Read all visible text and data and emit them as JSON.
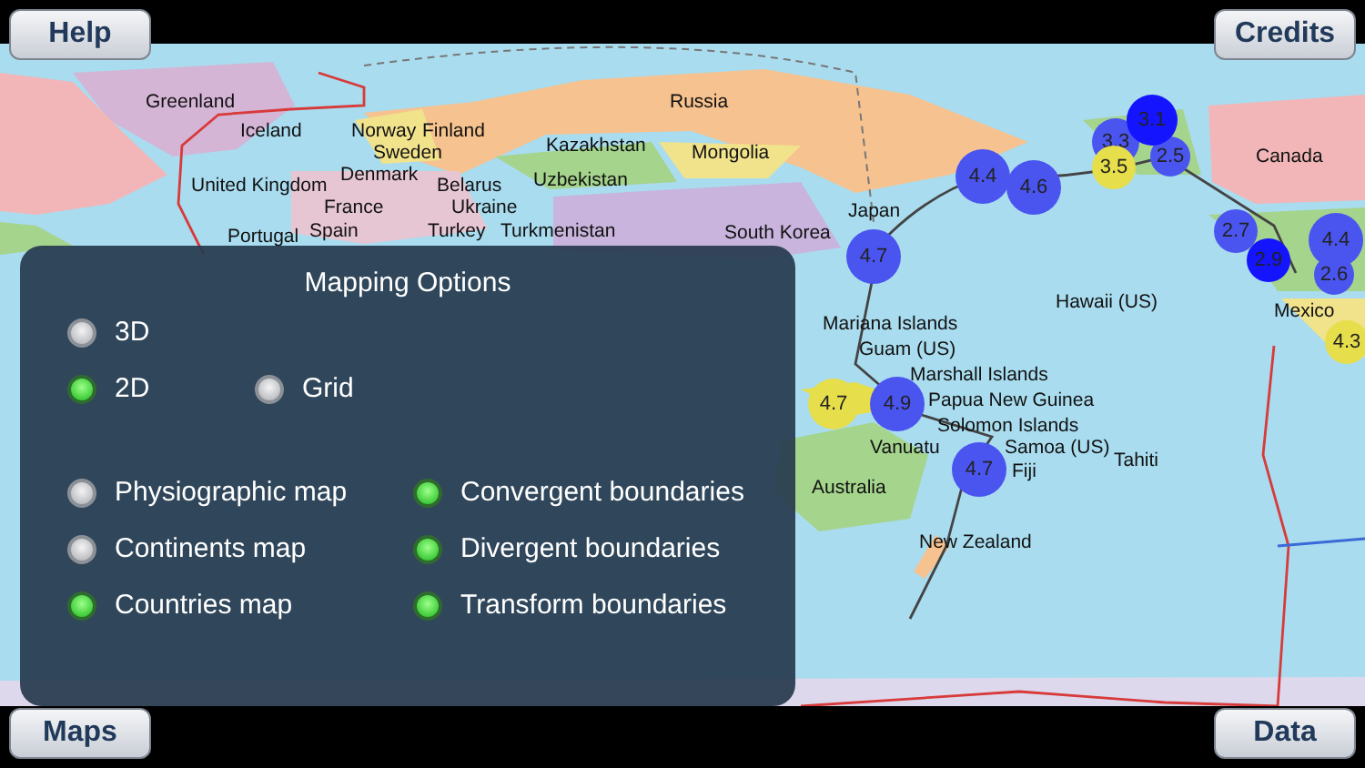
{
  "top_buttons": [
    {
      "label": "Help"
    },
    {
      "label": "Credits"
    }
  ],
  "bottom_buttons": [
    {
      "label": "Maps"
    },
    {
      "label": "Data"
    }
  ],
  "map_labels": [
    "Greenland",
    "Iceland",
    "Norway",
    "Finland",
    "Sweden",
    "Denmark",
    "United Kingdom",
    "Belarus",
    "France",
    "Ukraine",
    "Portugal",
    "Spain",
    "Turkey",
    "Turkmenistan",
    "Russia",
    "Kazakhstan",
    "Mongolia",
    "Uzbekistan",
    "South Korea",
    "Japan",
    "Mariana Islands",
    "Guam (US)",
    "Marshall Islands",
    "Papua New Guinea",
    "Solomon Islands",
    "Samoa (US)",
    "Fiji",
    "Tahiti",
    "Vanuatu",
    "Australia",
    "New Zealand",
    "Hawaii (US)",
    "Canada",
    "Mexico"
  ],
  "quakes": [
    {
      "magnitude": "4.4",
      "color": "#4a55f0"
    },
    {
      "magnitude": "4.6",
      "color": "#4a55f0"
    },
    {
      "magnitude": "3.3",
      "color": "#4a55f0"
    },
    {
      "magnitude": "3.5",
      "color": "#e6de4a"
    },
    {
      "magnitude": "2.5",
      "color": "#4a55f0"
    },
    {
      "magnitude": "3.1",
      "color": "#1414ff"
    },
    {
      "magnitude": "2.7",
      "color": "#4a55f0"
    },
    {
      "magnitude": "2.9",
      "color": "#1414ff"
    },
    {
      "magnitude": "4.4",
      "color": "#4a55f0"
    },
    {
      "magnitude": "2.6",
      "color": "#4a55f0"
    },
    {
      "magnitude": "4.3",
      "color": "#e6de4a"
    },
    {
      "magnitude": "4.7",
      "color": "#4a55f0"
    },
    {
      "magnitude": "4.7",
      "color": "#e6de4a"
    },
    {
      "magnitude": "4.9",
      "color": "#4a55f0"
    },
    {
      "magnitude": "4.7",
      "color": "#4a55f0"
    }
  ],
  "mapping_options": {
    "title": "Mapping Options",
    "view_modes": [
      {
        "label": "3D",
        "selected": false
      },
      {
        "label": "2D",
        "selected": true
      }
    ],
    "grid": {
      "label": "Grid",
      "on": false
    },
    "map_types": [
      {
        "label": "Physiographic map",
        "selected": false
      },
      {
        "label": "Continents map",
        "selected": false
      },
      {
        "label": "Countries map",
        "selected": true
      }
    ],
    "boundaries": [
      {
        "label": "Convergent boundaries",
        "on": true
      },
      {
        "label": "Divergent boundaries",
        "on": true
      },
      {
        "label": "Transform boundaries",
        "on": true
      }
    ]
  }
}
